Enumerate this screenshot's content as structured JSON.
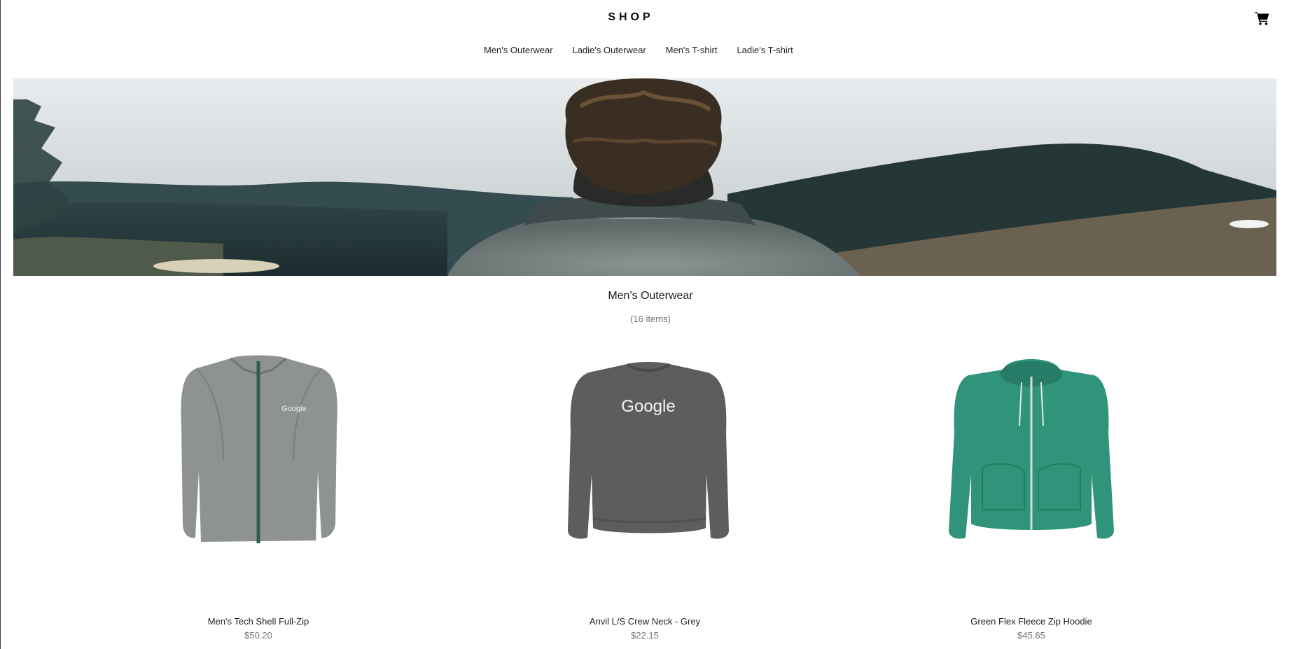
{
  "header": {
    "brand": "SHOP",
    "cart_icon": "cart-icon"
  },
  "tabs": [
    {
      "label": "Men's Outerwear"
    },
    {
      "label": "Ladie's Outerwear"
    },
    {
      "label": "Men's T-shirt"
    },
    {
      "label": "Ladie's T-shirt"
    }
  ],
  "category": {
    "title": "Men's Outerwear",
    "count": "(16 items)"
  },
  "products": [
    {
      "name": "Men's Tech Shell Full-Zip",
      "price": "$50.20",
      "logo_text": "Google",
      "color": "#8e9290"
    },
    {
      "name": "Anvil L/S Crew Neck - Grey",
      "price": "$22.15",
      "logo_text": "Google",
      "color": "#5d5d60"
    },
    {
      "name": "Green Flex Fleece Zip Hoodie",
      "price": "$45.65",
      "color": "#2f9479"
    }
  ]
}
